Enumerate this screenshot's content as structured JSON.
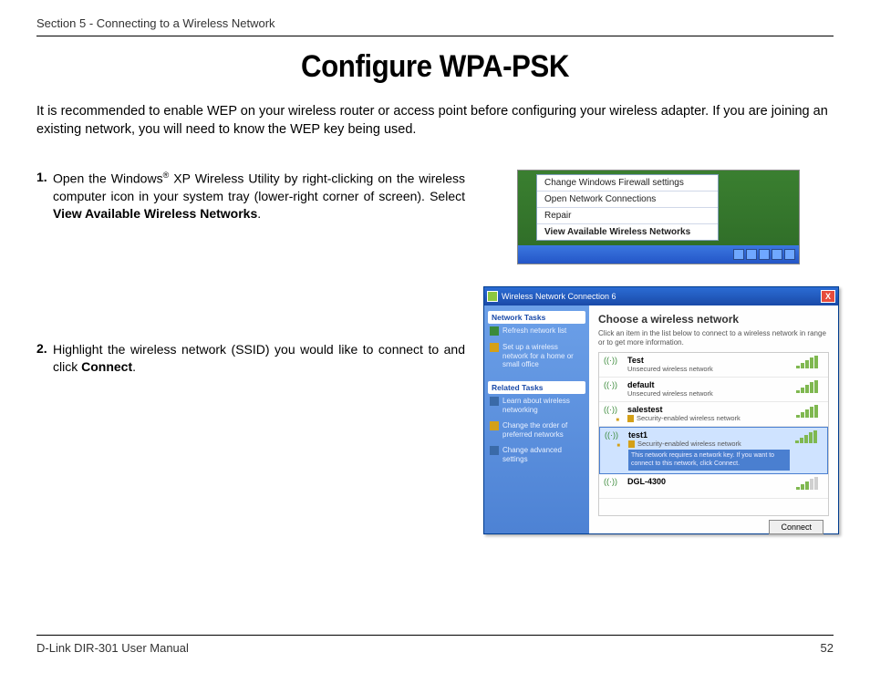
{
  "header": {
    "section": "Section 5 - Connecting to a Wireless Network"
  },
  "title": "Configure WPA-PSK",
  "intro": "It is recommended to enable WEP on your wireless router or access point before configuring your wireless adapter. If you are joining an existing network, you will need to know the WEP key being used.",
  "steps": [
    {
      "num": "1.",
      "pre": "Open the Windows",
      "sup": "®",
      "mid": " XP Wireless Utility by right-clicking on the wireless computer icon in your system tray (lower-right corner of screen). Select ",
      "bold": "View Available Wireless Networks",
      "post": "."
    },
    {
      "num": "2.",
      "pre": "Highlight the wireless network (SSID) you would like to connect to and click ",
      "bold": "Connect",
      "post": "."
    }
  ],
  "context_menu": {
    "items": [
      "Change Windows Firewall settings",
      "Open Network Connections",
      "Repair",
      "View Available Wireless Networks"
    ]
  },
  "dialog": {
    "title": "Wireless Network Connection 6",
    "sidebar": {
      "group1_title": "Network Tasks",
      "group1_links": [
        "Refresh network list",
        "Set up a wireless network for a home or small office"
      ],
      "group2_title": "Related Tasks",
      "group2_links": [
        "Learn about wireless networking",
        "Change the order of preferred networks",
        "Change advanced settings"
      ]
    },
    "main": {
      "heading": "Choose a wireless network",
      "sub": "Click an item in the list below to connect to a wireless network in range or to get more information.",
      "networks": [
        {
          "name": "Test",
          "security": "Unsecured wireless network",
          "secure": false,
          "bars": 5,
          "selected": false
        },
        {
          "name": "default",
          "security": "Unsecured wireless network",
          "secure": false,
          "bars": 5,
          "selected": false
        },
        {
          "name": "salestest",
          "security": "Security-enabled wireless network",
          "secure": true,
          "bars": 5,
          "selected": false
        },
        {
          "name": "test1",
          "security": "Security-enabled wireless network",
          "secure": true,
          "bars": 5,
          "selected": true,
          "note": "This network requires a network key. If you want to connect to this network, click Connect."
        },
        {
          "name": "DGL-4300",
          "security": "",
          "secure": false,
          "bars": 3,
          "selected": false
        }
      ],
      "connect_btn": "Connect"
    }
  },
  "footer": {
    "left": "D-Link DIR-301 User Manual",
    "right": "52"
  }
}
